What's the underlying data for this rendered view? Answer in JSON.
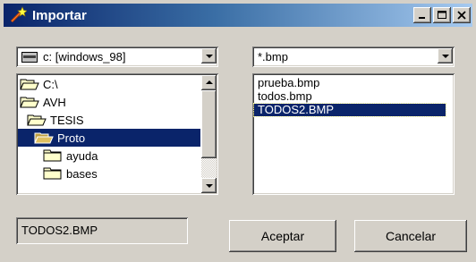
{
  "window": {
    "title": "Importar",
    "icon": "magic-wand-icon",
    "controls": [
      "minimize-icon",
      "maximize-icon",
      "close-icon"
    ]
  },
  "drive": {
    "selected": "c: [windows_98]",
    "icon": "drive-icon"
  },
  "filter": {
    "selected": "*.bmp"
  },
  "directories": [
    {
      "label": "C:\\",
      "icon": "open-folder-icon",
      "selected": false
    },
    {
      "label": "AVH",
      "icon": "open-folder-icon",
      "selected": false
    },
    {
      "label": "TESIS",
      "icon": "open-folder-icon",
      "selected": false
    },
    {
      "label": "Proto",
      "icon": "open-folder-icon",
      "selected": true
    },
    {
      "label": "ayuda",
      "icon": "folder-icon",
      "selected": false
    },
    {
      "label": "bases",
      "icon": "folder-icon",
      "selected": false
    }
  ],
  "files": [
    {
      "label": "prueba.bmp",
      "selected": false
    },
    {
      "label": "todos.bmp",
      "selected": false
    },
    {
      "label": "TODOS2.BMP",
      "selected": true
    }
  ],
  "filename": {
    "value": "TODOS2.BMP"
  },
  "buttons": {
    "accept_label": "Aceptar",
    "cancel_label": "Cancelar"
  },
  "colors": {
    "selection": "#0a246a",
    "title_start": "#0a246a",
    "title_end": "#a6caf0",
    "face": "#d4d0c8"
  }
}
